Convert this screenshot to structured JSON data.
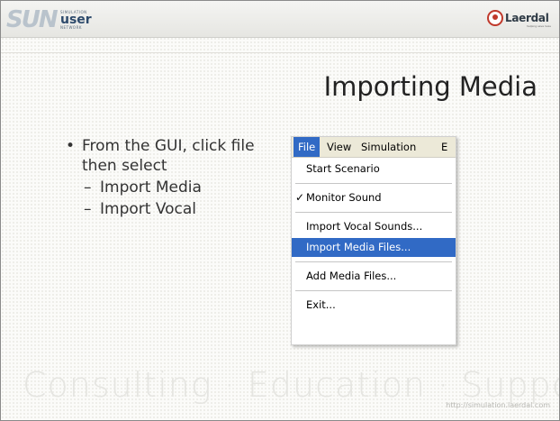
{
  "header": {
    "logo_letters": "SUN",
    "logo_small_top": "SIMULATION",
    "logo_user": "user",
    "logo_small_bottom": "NETWORK",
    "partner_logo": "Laerdal",
    "partner_tagline": "helping save lives"
  },
  "slide": {
    "title": "Importing Media",
    "bullet_main": "From the GUI, click file then select",
    "sub_bullets": [
      "Import Media",
      "Import Vocal"
    ]
  },
  "menu": {
    "menubar": [
      "File",
      "View",
      "Simulation",
      "E"
    ],
    "selected": "File",
    "items": [
      "Start Scenario",
      "Monitor Sound",
      "Import Vocal Sounds...",
      "Import Media Files...",
      "Add Media Files...",
      "Exit..."
    ],
    "checked_item": "Monitor Sound",
    "highlighted_item": "Import Media Files...",
    "highlight_color": "#316ac5"
  },
  "footer": {
    "tagline": "Consulting  ·  Education  ·  Support",
    "url": "http://simulation.laerdal.com"
  }
}
